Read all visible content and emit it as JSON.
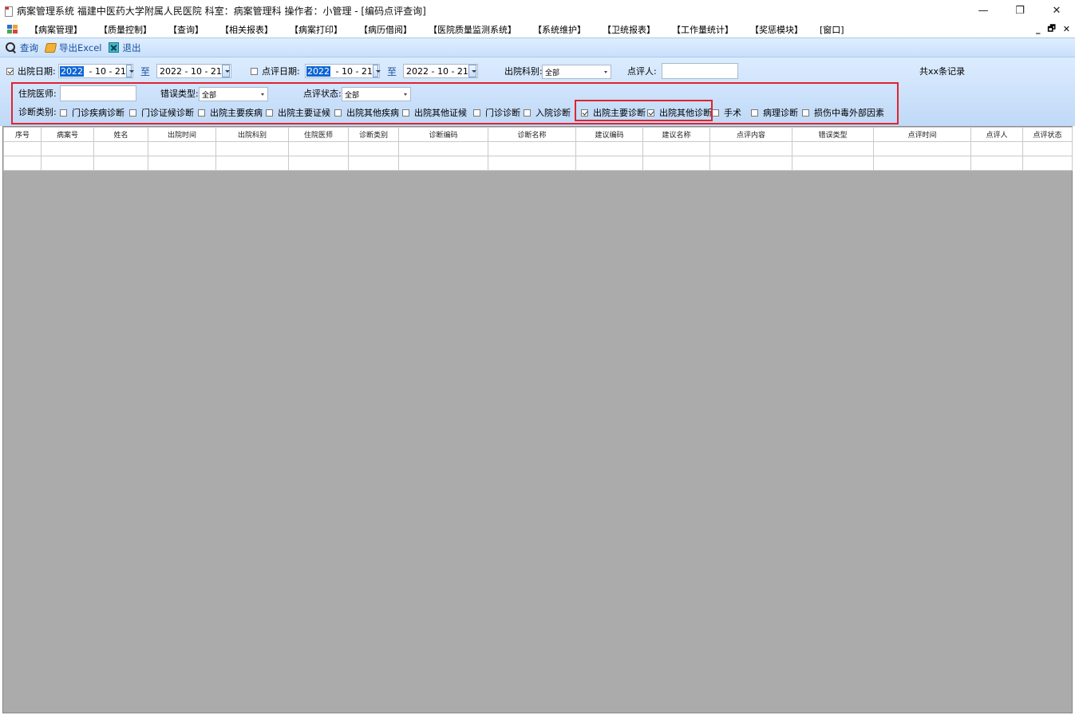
{
  "window": {
    "title": "病案管理系统 福建中医药大学附属人民医院 科室：病案管理科 操作者：小管理 - [编码点评查询]",
    "minimize": "—",
    "restore": "❐",
    "close": "✕"
  },
  "menu": {
    "items": [
      "【病案管理】",
      "【质量控制】",
      "【查询】",
      "【相关报表】",
      "【病案打印】",
      "【病历借阅】",
      "【医院质量监测系统】",
      "【系统维护】",
      "【卫统报表】",
      "【工作量统计】",
      "【奖惩模块】",
      "[窗口]"
    ],
    "mdi_minimize": "_",
    "mdi_restore": "🗗",
    "mdi_close": "✕"
  },
  "toolbar": {
    "query": "查询",
    "export": "导出Excel",
    "exit": "退出"
  },
  "filters": {
    "discharge_date_label": "出院日期:",
    "discharge_date_checked": true,
    "discharge_from": {
      "year": "2022",
      "rest": " - 10 - 21"
    },
    "to_label": "至",
    "discharge_to": "2022 - 10 - 21",
    "review_date_label": "点评日期:",
    "review_date_checked": false,
    "review_from": {
      "year": "2022",
      "rest": " - 10 - 21"
    },
    "review_to": "2022 - 10 - 21",
    "dept_label": "出院科别:",
    "dept_value": "全部",
    "reviewer_label": "点评人:",
    "reviewer_value": "",
    "record_count": "共xx条记录",
    "doctor_label": "住院医师:",
    "doctor_value": "",
    "error_type_label": "错误类型:",
    "error_type_value": "全部",
    "review_status_label": "点评状态:",
    "review_status_value": "全部",
    "diag_type_label": "诊断类别:",
    "diag_types": [
      {
        "label": "门诊疾病诊断",
        "checked": false
      },
      {
        "label": "门诊证候诊断",
        "checked": false
      },
      {
        "label": "出院主要疾病",
        "checked": false
      },
      {
        "label": "出院主要证候",
        "checked": false
      },
      {
        "label": "出院其他疾病",
        "checked": false
      },
      {
        "label": "出院其他证候",
        "checked": false
      },
      {
        "label": "门诊诊断",
        "checked": false
      },
      {
        "label": "入院诊断",
        "checked": false
      },
      {
        "label": "出院主要诊断",
        "checked": true
      },
      {
        "label": "出院其他诊断",
        "checked": true
      },
      {
        "label": "手术",
        "checked": false
      },
      {
        "label": "病理诊断",
        "checked": false
      },
      {
        "label": "损伤中毒外部因素",
        "checked": false
      }
    ]
  },
  "grid": {
    "columns": [
      "序号",
      "病案号",
      "姓名",
      "出院时间",
      "出院科别",
      "住院医师",
      "诊断类别",
      "诊断编码",
      "诊断名称",
      "建议编码",
      "建议名称",
      "点评内容",
      "错误类型",
      "点评时间",
      "点评人",
      "点评状态"
    ],
    "empty_rows": 2
  },
  "colors": {
    "accent_blue": "#1a4fa0",
    "highlight_red": "#e0242e",
    "panel_bg": "#cfe3fb",
    "grid_bg": "#ababab"
  }
}
